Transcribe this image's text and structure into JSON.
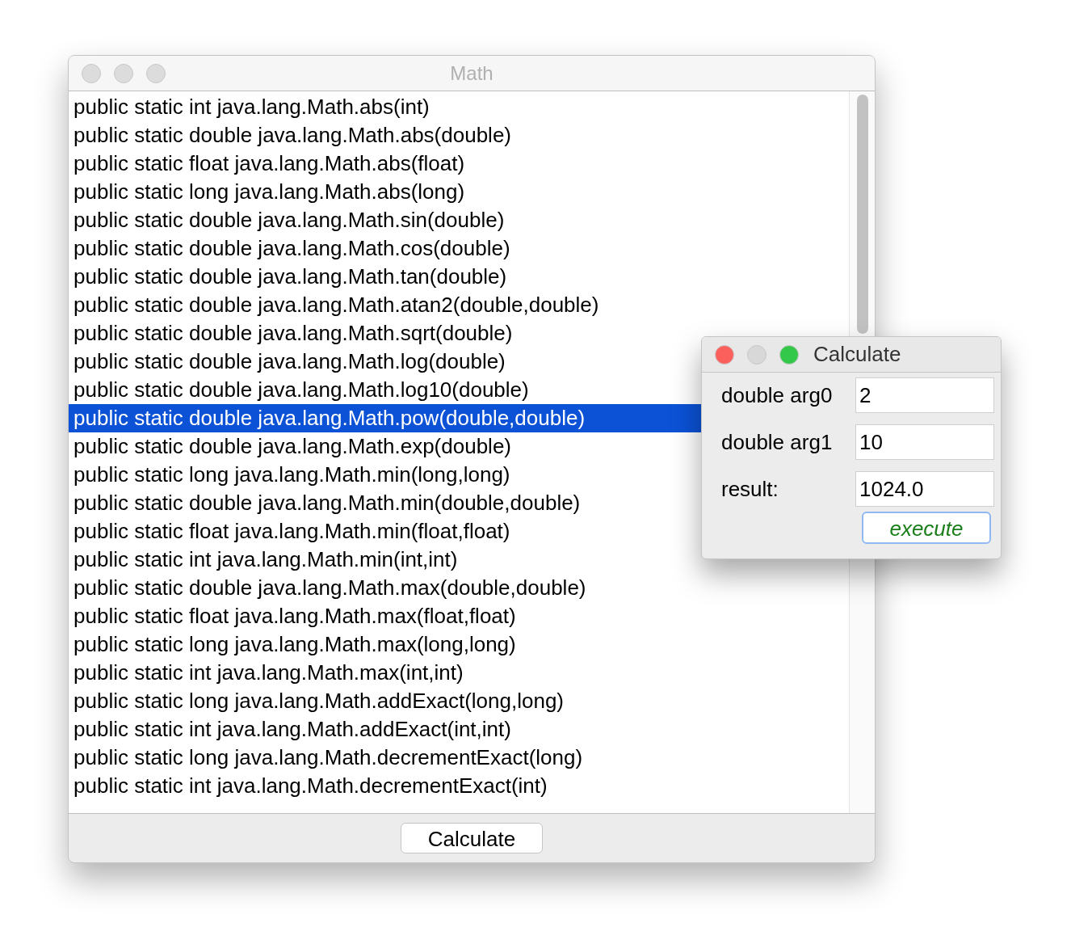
{
  "main_window": {
    "title": "Math",
    "active": false,
    "methods": [
      {
        "label": "public static int java.lang.Math.abs(int)",
        "selected": false
      },
      {
        "label": "public static double java.lang.Math.abs(double)",
        "selected": false
      },
      {
        "label": "public static float java.lang.Math.abs(float)",
        "selected": false
      },
      {
        "label": "public static long java.lang.Math.abs(long)",
        "selected": false
      },
      {
        "label": "public static double java.lang.Math.sin(double)",
        "selected": false
      },
      {
        "label": "public static double java.lang.Math.cos(double)",
        "selected": false
      },
      {
        "label": "public static double java.lang.Math.tan(double)",
        "selected": false
      },
      {
        "label": "public static double java.lang.Math.atan2(double,double)",
        "selected": false
      },
      {
        "label": "public static double java.lang.Math.sqrt(double)",
        "selected": false
      },
      {
        "label": "public static double java.lang.Math.log(double)",
        "selected": false
      },
      {
        "label": "public static double java.lang.Math.log10(double)",
        "selected": false
      },
      {
        "label": "public static double java.lang.Math.pow(double,double)",
        "selected": true
      },
      {
        "label": "public static double java.lang.Math.exp(double)",
        "selected": false
      },
      {
        "label": "public static long java.lang.Math.min(long,long)",
        "selected": false
      },
      {
        "label": "public static double java.lang.Math.min(double,double)",
        "selected": false
      },
      {
        "label": "public static float java.lang.Math.min(float,float)",
        "selected": false
      },
      {
        "label": "public static int java.lang.Math.min(int,int)",
        "selected": false
      },
      {
        "label": "public static double java.lang.Math.max(double,double)",
        "selected": false
      },
      {
        "label": "public static float java.lang.Math.max(float,float)",
        "selected": false
      },
      {
        "label": "public static long java.lang.Math.max(long,long)",
        "selected": false
      },
      {
        "label": "public static int java.lang.Math.max(int,int)",
        "selected": false
      },
      {
        "label": "public static long java.lang.Math.addExact(long,long)",
        "selected": false
      },
      {
        "label": "public static int java.lang.Math.addExact(int,int)",
        "selected": false
      },
      {
        "label": "public static long java.lang.Math.decrementExact(long)",
        "selected": false
      },
      {
        "label": "public static int java.lang.Math.decrementExact(int)",
        "selected": false
      }
    ],
    "button": "Calculate"
  },
  "dialog": {
    "title": "Calculate",
    "active": true,
    "fields": [
      {
        "label": "double arg0",
        "value": "2"
      },
      {
        "label": "double arg1",
        "value": "10"
      },
      {
        "label": "result:",
        "value": "1024.0"
      }
    ],
    "button": "execute"
  }
}
